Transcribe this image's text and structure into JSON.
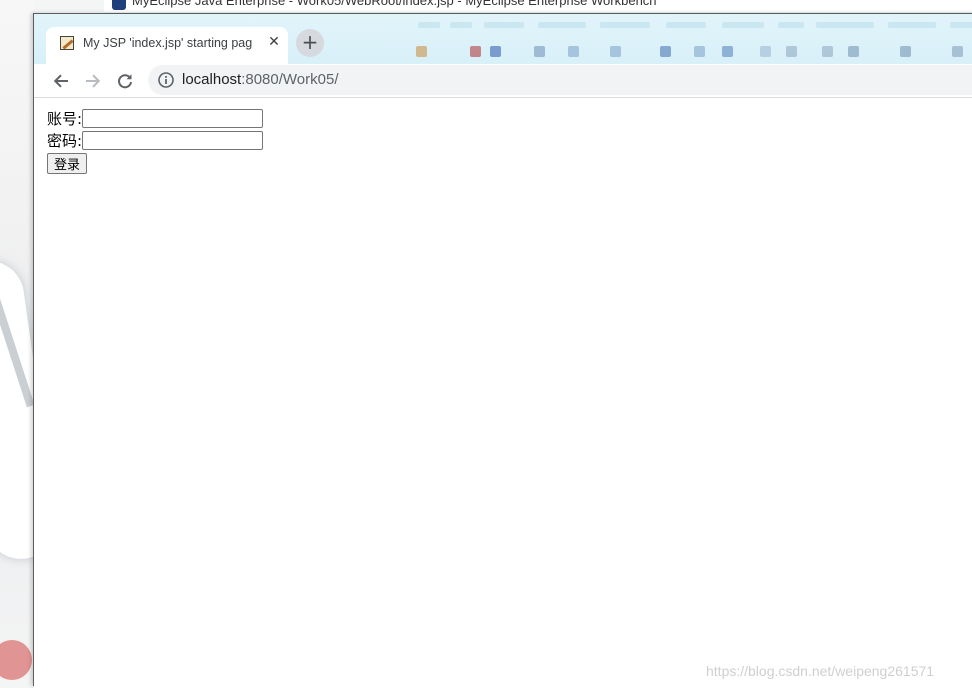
{
  "background": {
    "ide_title": "MyEclipse Java Enterprise - Work05/WebRoot/index.jsp - MyEclipse Enterprise Workbench"
  },
  "browser": {
    "tab": {
      "title": "My JSP 'index.jsp' starting pag",
      "close_icon": "close-icon",
      "favicon": "page-favicon-icon"
    },
    "new_tab": {
      "label": "+"
    },
    "nav": {
      "back_icon": "arrow-left-icon",
      "forward_icon": "arrow-right-icon",
      "reload_icon": "reload-icon"
    },
    "address": {
      "info_icon": "info-icon",
      "host": "localhost",
      "path": ":8080/Work05/"
    }
  },
  "page": {
    "form": {
      "username_label": "账号:",
      "username_value": "",
      "password_label": "密码:",
      "password_value": "",
      "submit_label": "登录"
    }
  },
  "watermark": "https://blog.csdn.net/weipeng261571",
  "colors": {
    "tabstrip_bg": "#d6eff8",
    "omnibox_bg": "#f1f3f4",
    "text_primary": "#202124",
    "text_secondary": "#5f6368"
  }
}
